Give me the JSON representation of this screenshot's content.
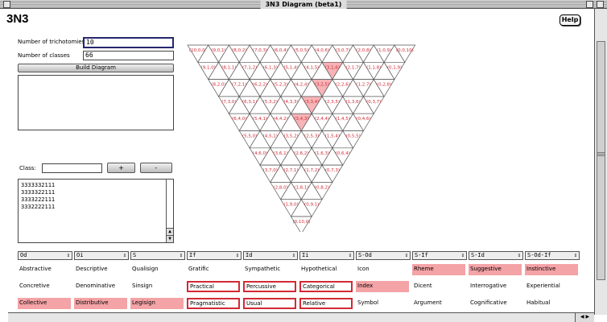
{
  "window": {
    "title": "3N3 Diagram (beta1)"
  },
  "app": {
    "title": "3N3",
    "help_label": "Help"
  },
  "form": {
    "trichotomies_label": "Number of trichotomies",
    "trichotomies_value": "10",
    "classes_label": "Number of classes",
    "classes_value": "66",
    "build_label": "Build Diagram",
    "class_label": "Class:",
    "class_value": "",
    "plus_label": "+",
    "minus_label": "-"
  },
  "class_list": [
    "3333332111",
    "3333322111",
    "3333222111",
    "3332222111"
  ],
  "diagram": {
    "rows": [
      [
        "10,0,0",
        "9,0,1",
        "8,0,2",
        "7,0,3",
        "6,0,4",
        "5,0,5",
        "4,0,6",
        "3,0,7",
        "2,0,8",
        "1,0,9",
        "0,0,10"
      ],
      [
        "9,1,0",
        "8,1,1",
        "7,1,2",
        "6,1,3",
        "5,1,4",
        "4,1,5",
        "3,1,6",
        "2,1,7",
        "1,1,8",
        "0,1,9"
      ],
      [
        "8,2,0",
        "7,2,1",
        "6,2,2",
        "5,2,3",
        "4,2,4",
        "3,2,5",
        "2,2,6",
        "1,2,7",
        "0,2,8"
      ],
      [
        "7,3,0",
        "6,3,1",
        "5,3,2",
        "4,3,3",
        "3,3,4",
        "2,3,5",
        "1,3,6",
        "0,3,7"
      ],
      [
        "6,4,0",
        "5,4,1",
        "4,4,2",
        "3,4,3",
        "2,4,4",
        "1,4,5",
        "0,4,6"
      ],
      [
        "5,5,0",
        "4,5,1",
        "3,5,2",
        "2,5,3",
        "1,5,4",
        "0,5,5"
      ],
      [
        "4,6,0",
        "3,6,1",
        "2,6,2",
        "1,6,3",
        "0,6,4"
      ],
      [
        "3,7,0",
        "2,7,1",
        "1,7,2",
        "0,7,3"
      ],
      [
        "2,8,0",
        "1,8,1",
        "0,8,2"
      ],
      [
        "1,9,0",
        "0,9,1"
      ],
      [
        "0,10,0"
      ]
    ],
    "highlighted": [
      "3,1,6",
      "3,2,5",
      "3,3,4",
      "3,4,3"
    ],
    "label_color": "#d22a35",
    "highlight_color": "#f7b3b6"
  },
  "table": {
    "headers": [
      "Od",
      "Oi",
      "S",
      "If",
      "Id",
      "Ii",
      "S-Od",
      "S-If",
      "S-Id",
      "S-Od-If"
    ],
    "rows": [
      [
        "Abstractive",
        "Descriptive",
        "Qualisign",
        "Gratific",
        "Sympathetic",
        "Hypothetical",
        "Icon",
        "Rheme",
        "Suggestive",
        "Instinctive"
      ],
      [
        "Concretive",
        "Denominative",
        "Sinsign",
        "Practical",
        "Percussive",
        "Categorical",
        "Index",
        "Dicent",
        "Interrogative",
        "Experiential"
      ],
      [
        "Collective",
        "Distributive",
        "Legisign",
        "Pragmatistic",
        "Usual",
        "Relative",
        "Symbol",
        "Argument",
        "Cognificative",
        "Habitual"
      ]
    ],
    "pink": [
      [
        0,
        7
      ],
      [
        0,
        8
      ],
      [
        0,
        9
      ],
      [
        1,
        6
      ],
      [
        2,
        0
      ],
      [
        2,
        1
      ],
      [
        2,
        2
      ]
    ],
    "outlined": [
      [
        1,
        3
      ],
      [
        1,
        4
      ],
      [
        1,
        5
      ],
      [
        2,
        3
      ],
      [
        2,
        4
      ],
      [
        2,
        5
      ]
    ],
    "pink_color": "#f4a3a6",
    "outline_color": "#d22a35"
  }
}
